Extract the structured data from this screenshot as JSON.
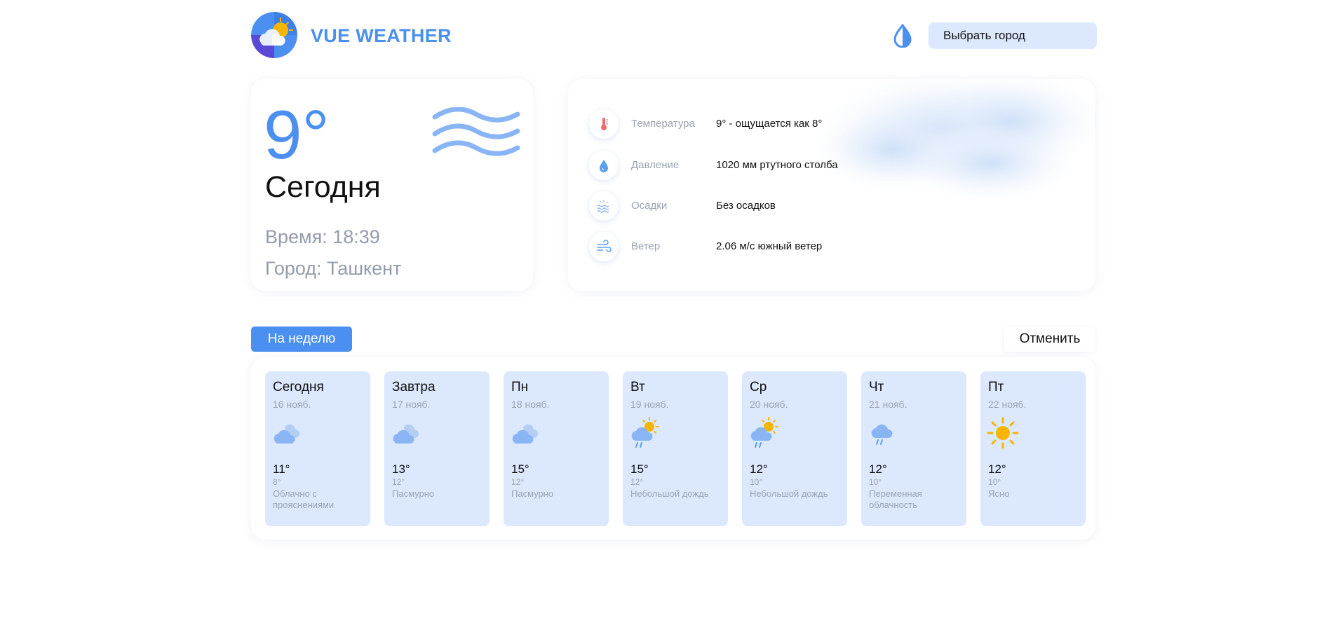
{
  "header": {
    "brand": "VUE WEATHER",
    "city_button_label": "Выбрать город"
  },
  "today": {
    "temperature": "9°",
    "label": "Сегодня",
    "time": "Время: 18:39",
    "city": "Город: Ташкент"
  },
  "details": [
    {
      "icon": "thermometer-icon",
      "label": "Температура",
      "value": "9° - ощущается как 8°"
    },
    {
      "icon": "drop-icon",
      "label": "Давление",
      "value": "1020 мм ртутного столба"
    },
    {
      "icon": "precipitation-icon",
      "label": "Осадки",
      "value": "Без осадков"
    },
    {
      "icon": "wind-icon",
      "label": "Ветер",
      "value": "2.06 м/с южный ветер"
    }
  ],
  "tabs": {
    "week_label": "На неделю",
    "cancel_label": "Отменить"
  },
  "forecast": [
    {
      "day": "Сегодня",
      "date": "16 нояб.",
      "max": "11°",
      "min": "8°",
      "desc": "Облачно с прояснениями",
      "icon": "cloudy-icon"
    },
    {
      "day": "Завтра",
      "date": "17 нояб.",
      "max": "13°",
      "min": "12°",
      "desc": "Пасмурно",
      "icon": "cloudy-icon"
    },
    {
      "day": "Пн",
      "date": "18 нояб.",
      "max": "15°",
      "min": "12°",
      "desc": "Пасмурно",
      "icon": "cloudy-icon"
    },
    {
      "day": "Вт",
      "date": "19 нояб.",
      "max": "15°",
      "min": "12°",
      "desc": "Небольшой дождь",
      "icon": "sun-rain-icon"
    },
    {
      "day": "Ср",
      "date": "20 нояб.",
      "max": "12°",
      "min": "10°",
      "desc": "Небольшой дождь",
      "icon": "sun-rain-icon"
    },
    {
      "day": "Чт",
      "date": "21 нояб.",
      "max": "12°",
      "min": "10°",
      "desc": "Переменная облачность",
      "icon": "rain-cloud-icon"
    },
    {
      "day": "Пт",
      "date": "22 нояб.",
      "max": "12°",
      "min": "10°",
      "desc": "Ясно",
      "icon": "sun-icon"
    }
  ],
  "colors": {
    "accent": "#4b8ff0",
    "card_bg": "#dbe8fd",
    "muted_text": "#9aa3b2",
    "sun": "#f8b500"
  }
}
